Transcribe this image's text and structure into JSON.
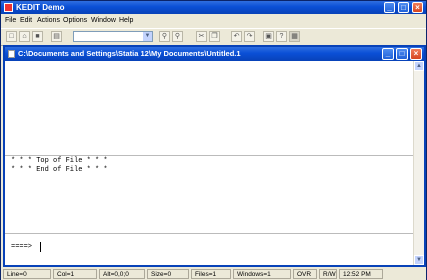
{
  "app": {
    "title": "KEDIT Demo",
    "menu": [
      "File",
      "Edit",
      "Actions",
      "Options",
      "Window",
      "Help"
    ]
  },
  "toolbar": {
    "buttons": [
      "new-icon",
      "open-icon",
      "save-icon",
      "print-icon",
      "find-icon",
      "find-next-icon",
      "cut-icon",
      "copy-icon",
      "paste-icon",
      "undo-icon",
      "redo-icon",
      "help-icon",
      "options-icon"
    ],
    "combo_value": ""
  },
  "document": {
    "title": "C:\\Documents and Settings\\Statia 12\\My Documents\\Untitled.1",
    "top_of_file": "* * * Top of File * * *",
    "end_of_file": "* * * End of File * * *",
    "prompt": "====>"
  },
  "status": {
    "line": "Line=0",
    "col": "Col=1",
    "alt": "Alt=0,0;0",
    "size": "Size=0",
    "files": "Files=1",
    "windows": "Windows=1",
    "mode": "OVR",
    "rw": "R/W",
    "time": "12:52 PM"
  },
  "colors": {
    "titlebar": "#0a4fd6",
    "face": "#ece9d8"
  }
}
